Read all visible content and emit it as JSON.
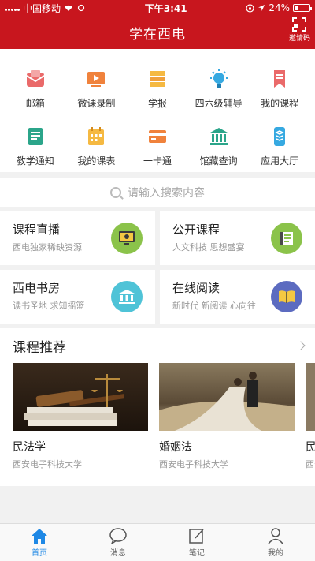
{
  "status_bar": {
    "carrier": "中国移动",
    "time": "下午3:41",
    "battery": "24%",
    "battery_level": 0.24
  },
  "header": {
    "title": "学在西电",
    "invite_label": "邀请码"
  },
  "grid": [
    {
      "label": "邮箱",
      "icon": "mail-icon",
      "color": "#ea6a6a"
    },
    {
      "label": "微课录制",
      "icon": "video-icon",
      "color": "#f0823c"
    },
    {
      "label": "学报",
      "icon": "journal-icon",
      "color": "#f0a03c"
    },
    {
      "label": "四六级辅导",
      "icon": "lightbulb-icon",
      "color": "#36a9e1"
    },
    {
      "label": "我的课程",
      "icon": "bookmark-icon",
      "color": "#ea6a6a"
    },
    {
      "label": "教学通知",
      "icon": "notice-icon",
      "color": "#2ba58a"
    },
    {
      "label": "我的课表",
      "icon": "calendar-icon",
      "color": "#f5b942"
    },
    {
      "label": "一卡通",
      "icon": "card-icon",
      "color": "#f0823c"
    },
    {
      "label": "馆藏查询",
      "icon": "library-icon",
      "color": "#2ba58a"
    },
    {
      "label": "应用大厅",
      "icon": "apps-icon",
      "color": "#36a9e1"
    }
  ],
  "search": {
    "placeholder": "请输入搜索内容"
  },
  "cards": [
    {
      "title": "课程直播",
      "subtitle": "西电独家稀缺资源",
      "icon": "live-icon",
      "color": "#8bc34a"
    },
    {
      "title": "公开课程",
      "subtitle": "人文科技 思想盛宴",
      "icon": "book-open-icon",
      "color": "#8bc34a"
    },
    {
      "title": "西电书房",
      "subtitle": "读书圣地 求知摇篮",
      "icon": "building-icon",
      "color": "#4fc3d7"
    },
    {
      "title": "在线阅读",
      "subtitle": "新时代 新阅读 心向往",
      "icon": "reading-icon",
      "color": "#5c6bc0"
    }
  ],
  "recommend": {
    "title": "课程推荐",
    "items": [
      {
        "name": "民法学",
        "school": "西安电子科技大学"
      },
      {
        "name": "婚姻法",
        "school": "西安电子科技大学"
      },
      {
        "name": "民",
        "school": "西安"
      }
    ]
  },
  "tabs": [
    {
      "label": "首页",
      "icon": "home-icon",
      "active": true
    },
    {
      "label": "消息",
      "icon": "message-icon",
      "active": false
    },
    {
      "label": "笔记",
      "icon": "note-icon",
      "active": false
    },
    {
      "label": "我的",
      "icon": "user-icon",
      "active": false
    }
  ],
  "colors": {
    "brand": "#c8161e",
    "tab_active": "#1e88e5"
  }
}
